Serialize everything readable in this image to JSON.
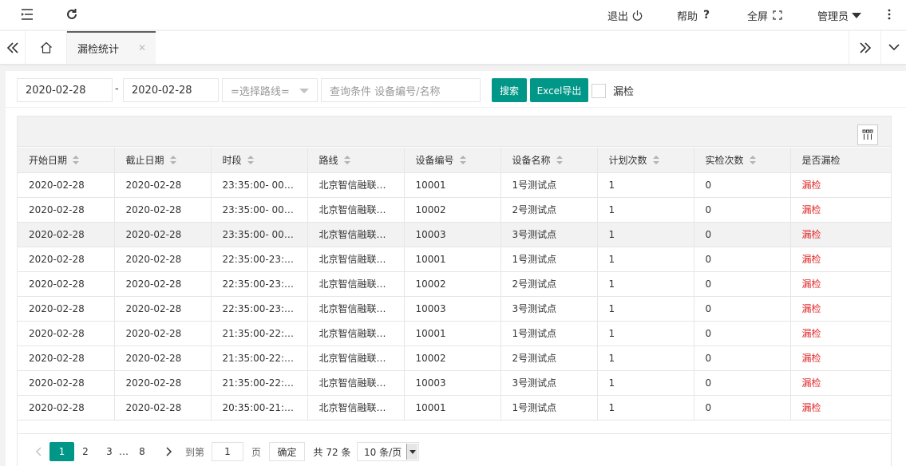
{
  "topbar": {
    "logout": "退出",
    "help": "帮助",
    "fullscreen": "全屏",
    "admin": "管理员"
  },
  "tabs": {
    "active": "漏检统计"
  },
  "search": {
    "start_date": "2020-02-28",
    "separator": "-",
    "end_date": "2020-02-28",
    "route_placeholder": "=选择路线=",
    "query_placeholder": "查询条件 设备编号/名称",
    "search_button": "搜索",
    "export_button": "Excel导出",
    "missed_label": "漏检"
  },
  "table": {
    "headers": [
      "开始日期",
      "截止日期",
      "时段",
      "路线",
      "设备编号",
      "设备名称",
      "计划次数",
      "实检次数",
      "是否漏检"
    ],
    "rows": [
      [
        "2020-02-28",
        "2020-02-28",
        "23:35:00- 00:…",
        "北京智信融联…",
        "10001",
        "1号测试点",
        "1",
        "0",
        "漏检"
      ],
      [
        "2020-02-28",
        "2020-02-28",
        "23:35:00- 00:…",
        "北京智信融联…",
        "10002",
        "2号测试点",
        "1",
        "0",
        "漏检"
      ],
      [
        "2020-02-28",
        "2020-02-28",
        "23:35:00- 00:…",
        "北京智信融联…",
        "10003",
        "3号测试点",
        "1",
        "0",
        "漏检"
      ],
      [
        "2020-02-28",
        "2020-02-28",
        "22:35:00-23:2…",
        "北京智信融联…",
        "10001",
        "1号测试点",
        "1",
        "0",
        "漏检"
      ],
      [
        "2020-02-28",
        "2020-02-28",
        "22:35:00-23:2…",
        "北京智信融联…",
        "10002",
        "2号测试点",
        "1",
        "0",
        "漏检"
      ],
      [
        "2020-02-28",
        "2020-02-28",
        "22:35:00-23:2…",
        "北京智信融联…",
        "10003",
        "3号测试点",
        "1",
        "0",
        "漏检"
      ],
      [
        "2020-02-28",
        "2020-02-28",
        "21:35:00-22:2…",
        "北京智信融联…",
        "10001",
        "1号测试点",
        "1",
        "0",
        "漏检"
      ],
      [
        "2020-02-28",
        "2020-02-28",
        "21:35:00-22:2…",
        "北京智信融联…",
        "10002",
        "2号测试点",
        "1",
        "0",
        "漏检"
      ],
      [
        "2020-02-28",
        "2020-02-28",
        "21:35:00-22:2…",
        "北京智信融联…",
        "10003",
        "3号测试点",
        "1",
        "0",
        "漏检"
      ],
      [
        "2020-02-28",
        "2020-02-28",
        "20:35:00-21:2…",
        "北京智信融联…",
        "10001",
        "1号测试点",
        "1",
        "0",
        "漏检"
      ]
    ]
  },
  "pager": {
    "pages": [
      "1",
      "2",
      "3",
      "…",
      "8"
    ],
    "current": "1",
    "goto_label": "到第",
    "goto_value": "1",
    "page_unit": "页",
    "confirm": "确定",
    "total": "共 72 条",
    "page_size": "10 条/页"
  },
  "colors": {
    "primary": "#009688",
    "missed": "#e12b2b"
  }
}
